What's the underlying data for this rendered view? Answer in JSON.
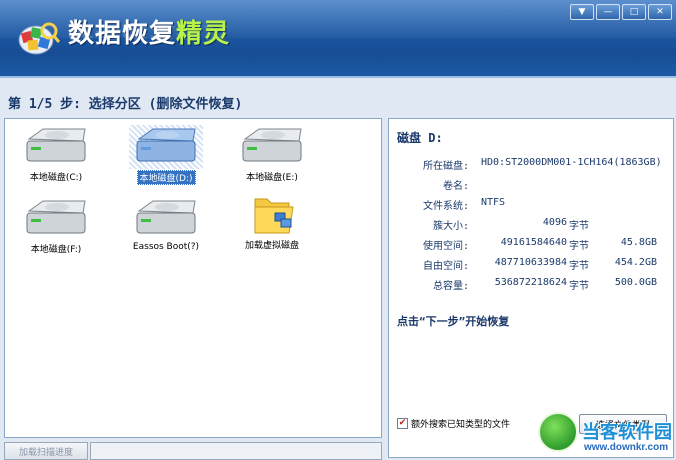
{
  "app": {
    "title_main": "数据恢复",
    "title_highlight": "精灵",
    "window_buttons": [
      "▼",
      "—",
      "□",
      "✕"
    ]
  },
  "step": {
    "title": "第 1/5 步: 选择分区 (删除文件恢复)"
  },
  "drives": [
    {
      "label": "本地磁盘(C:)",
      "icon": "hard-drive-icon",
      "selected": false
    },
    {
      "label": "本地磁盘(D:)",
      "icon": "hard-drive-icon",
      "selected": true
    },
    {
      "label": "本地磁盘(E:)",
      "icon": "hard-drive-icon",
      "selected": false
    },
    {
      "label": "本地磁盘(F:)",
      "icon": "hard-drive-icon",
      "selected": false
    },
    {
      "label": "Eassos Boot(?)",
      "icon": "hard-drive-icon",
      "selected": false
    },
    {
      "label": "加载虚拟磁盘",
      "icon": "folder-icon",
      "selected": false
    }
  ],
  "disk_info": {
    "title": "磁盘 D:",
    "rows": [
      {
        "label": "所在磁盘:",
        "value": "HD0:ST2000DM001-1CH164(1863GB)"
      },
      {
        "label": "卷名:",
        "value": ""
      },
      {
        "label": "文件系统:",
        "value": "NTFS"
      },
      {
        "label": "簇大小:",
        "value": "4096",
        "unit": "字节",
        "extra": ""
      },
      {
        "label": "使用空间:",
        "value": "49161584640",
        "unit": "字节",
        "extra": "45.8GB"
      },
      {
        "label": "自由空间:",
        "value": "487710633984",
        "unit": "字节",
        "extra": "454.2GB"
      },
      {
        "label": "总容量:",
        "value": "536872218624",
        "unit": "字节",
        "extra": "500.0GB"
      }
    ],
    "hint": "点击“下一步”开始恢复"
  },
  "options": {
    "extra_search_label": "额外搜索已知类型的文件",
    "extra_search_checked": true,
    "filetype_button": "选择文件类型"
  },
  "bottom": {
    "progress_button": "加载扫描进度"
  },
  "watermark": {
    "name": "当客软件园",
    "url": "www.downkr.com"
  },
  "colors": {
    "titlebar": "#1e5ba8",
    "accent_green": "#b8f24a",
    "selected_blue": "#3472c4"
  }
}
